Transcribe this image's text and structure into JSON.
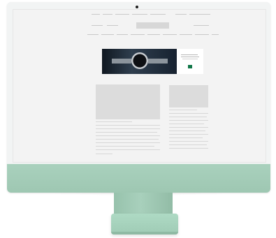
{
  "scene": {
    "monitor_color": "#a9d1bd",
    "device": "desktop-monitor"
  },
  "screen_page": {
    "ad_banner": {
      "brand_icon": "crown-logo-icon",
      "product_image": "wristwatch-image"
    }
  }
}
